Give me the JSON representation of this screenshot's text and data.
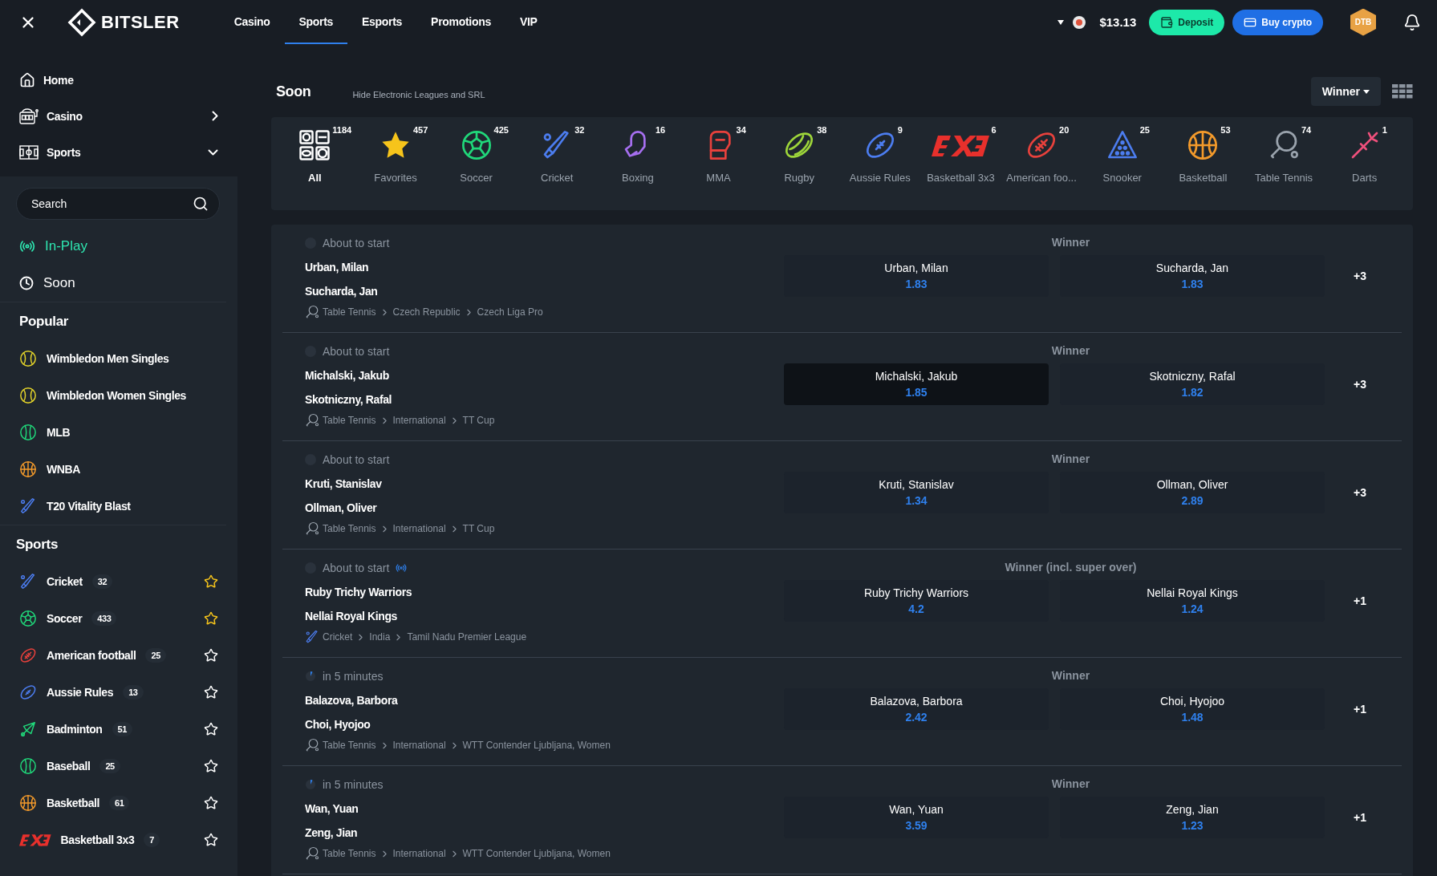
{
  "topbar": {
    "brand": "BITSLER",
    "nav": [
      {
        "label": "Casino",
        "selected": false
      },
      {
        "label": "Sports",
        "selected": true
      },
      {
        "label": "Esports",
        "selected": false
      },
      {
        "label": "Promotions",
        "selected": false
      },
      {
        "label": "VIP",
        "selected": false
      }
    ],
    "balance": "$13.13",
    "deposit": "Deposit",
    "buy_crypto": "Buy crypto",
    "avatar": "DTB"
  },
  "sidebar": {
    "main": [
      {
        "label": "Home",
        "kind": "home"
      },
      {
        "label": "Casino",
        "kind": "casino",
        "expanded": false
      },
      {
        "label": "Sports",
        "kind": "sports",
        "expanded": true
      }
    ],
    "search": {
      "placeholder": "Search"
    },
    "quick": [
      {
        "label": "In-Play",
        "kind": "live"
      },
      {
        "label": "Soon",
        "kind": "clock"
      }
    ],
    "popular": {
      "title": "Popular",
      "items": [
        {
          "label": "Wimbledon Men Singles",
          "kind": "tennis"
        },
        {
          "label": "Wimbledon Women Singles",
          "kind": "tennis"
        },
        {
          "label": "MLB",
          "kind": "baseball"
        },
        {
          "label": "WNBA",
          "kind": "basketball"
        },
        {
          "label": "T20 Vitality Blast",
          "kind": "cricket"
        }
      ]
    },
    "sports": {
      "title": "Sports",
      "items": [
        {
          "label": "Cricket",
          "count": "32",
          "kind": "cricket",
          "favorite": true
        },
        {
          "label": "Soccer",
          "count": "433",
          "kind": "soccer",
          "favorite": true
        },
        {
          "label": "American football",
          "count": "25",
          "kind": "football",
          "favorite": false
        },
        {
          "label": "Aussie Rules",
          "count": "13",
          "kind": "aussie",
          "favorite": false
        },
        {
          "label": "Badminton",
          "count": "51",
          "kind": "badminton",
          "favorite": false
        },
        {
          "label": "Baseball",
          "count": "25",
          "kind": "baseball",
          "favorite": false
        },
        {
          "label": "Basketball",
          "count": "61",
          "kind": "basketball",
          "favorite": false
        },
        {
          "label": "Basketball 3x3",
          "count": "7",
          "kind": "b3x3",
          "favorite": false
        }
      ]
    }
  },
  "main": {
    "title": "Soon",
    "toggle": "Hide Electronic Leagues and SRL",
    "market_select": "Winner",
    "filters": [
      {
        "label": "All",
        "count": "1184",
        "kind": "all",
        "selected": true
      },
      {
        "label": "Favorites",
        "count": "457",
        "kind": "star",
        "selected": false
      },
      {
        "label": "Soccer",
        "count": "425",
        "kind": "soccer",
        "selected": false
      },
      {
        "label": "Cricket",
        "count": "32",
        "kind": "cricket",
        "selected": false
      },
      {
        "label": "Boxing",
        "count": "16",
        "kind": "boxing",
        "selected": false
      },
      {
        "label": "MMA",
        "count": "34",
        "kind": "mma",
        "selected": false
      },
      {
        "label": "Rugby",
        "count": "38",
        "kind": "rugby",
        "selected": false
      },
      {
        "label": "Aussie Rules",
        "count": "9",
        "kind": "aussie",
        "selected": false
      },
      {
        "label": "Basketball 3x3",
        "count": "6",
        "kind": "b3x3",
        "selected": false
      },
      {
        "label": "American foo...",
        "count": "20",
        "kind": "football",
        "selected": false
      },
      {
        "label": "Snooker",
        "count": "25",
        "kind": "snooker",
        "selected": false
      },
      {
        "label": "Basketball",
        "count": "53",
        "kind": "basketball",
        "selected": false
      },
      {
        "label": "Table Tennis",
        "count": "74",
        "kind": "tabletennis",
        "selected": false
      },
      {
        "label": "Darts",
        "count": "1",
        "kind": "darts",
        "selected": false
      }
    ],
    "events": [
      {
        "status": {
          "text": "About to start",
          "kind": "dot"
        },
        "live": false,
        "teams": [
          "Urban, Milan",
          "Sucharda, Jan"
        ],
        "kind": "tabletennis",
        "path": [
          "Table Tennis",
          "Czech Republic",
          "Czech Liga Pro"
        ],
        "market": "Winner",
        "odds": [
          {
            "name": "Urban, Milan",
            "price": "1.83",
            "selected": false
          },
          {
            "name": "Sucharda, Jan",
            "price": "1.83",
            "selected": false
          }
        ],
        "more": "+3"
      },
      {
        "status": {
          "text": "About to start",
          "kind": "dot"
        },
        "live": false,
        "teams": [
          "Michalski, Jakub",
          "Skotniczny, Rafal"
        ],
        "kind": "tabletennis",
        "path": [
          "Table Tennis",
          "International",
          "TT Cup"
        ],
        "market": "Winner",
        "odds": [
          {
            "name": "Michalski, Jakub",
            "price": "1.85",
            "selected": true
          },
          {
            "name": "Skotniczny, Rafal",
            "price": "1.82",
            "selected": false
          }
        ],
        "more": "+3"
      },
      {
        "status": {
          "text": "About to start",
          "kind": "dot"
        },
        "live": false,
        "teams": [
          "Kruti, Stanislav",
          "Ollman, Oliver"
        ],
        "kind": "tabletennis",
        "path": [
          "Table Tennis",
          "International",
          "TT Cup"
        ],
        "market": "Winner",
        "odds": [
          {
            "name": "Kruti, Stanislav",
            "price": "1.34",
            "selected": false
          },
          {
            "name": "Ollman, Oliver",
            "price": "2.89",
            "selected": false
          }
        ],
        "more": "+3"
      },
      {
        "status": {
          "text": "About to start",
          "kind": "dot"
        },
        "live": true,
        "teams": [
          "Ruby Trichy Warriors",
          "Nellai Royal Kings"
        ],
        "kind": "cricket",
        "path": [
          "Cricket",
          "India",
          "Tamil Nadu Premier League"
        ],
        "market": "Winner (incl. super over)",
        "odds": [
          {
            "name": "Ruby Trichy Warriors",
            "price": "4.2",
            "selected": false
          },
          {
            "name": "Nellai Royal Kings",
            "price": "1.24",
            "selected": false
          }
        ],
        "more": "+1"
      },
      {
        "status": {
          "text": "in 5 minutes",
          "kind": "timer"
        },
        "live": false,
        "teams": [
          "Balazova, Barbora",
          "Choi, Hyojoo"
        ],
        "kind": "tabletennis",
        "path": [
          "Table Tennis",
          "International",
          "WTT Contender Ljubljana, Women"
        ],
        "market": "Winner",
        "odds": [
          {
            "name": "Balazova, Barbora",
            "price": "2.42",
            "selected": false
          },
          {
            "name": "Choi, Hyojoo",
            "price": "1.48",
            "selected": false
          }
        ],
        "more": "+1"
      },
      {
        "status": {
          "text": "in 5 minutes",
          "kind": "timer"
        },
        "live": false,
        "teams": [
          "Wan, Yuan",
          "Zeng, Jian"
        ],
        "kind": "tabletennis",
        "path": [
          "Table Tennis",
          "International",
          "WTT Contender Ljubljana, Women"
        ],
        "market": "Winner",
        "odds": [
          {
            "name": "Wan, Yuan",
            "price": "3.59",
            "selected": false
          },
          {
            "name": "Zeng, Jian",
            "price": "1.23",
            "selected": false
          }
        ],
        "more": "+1"
      }
    ]
  }
}
